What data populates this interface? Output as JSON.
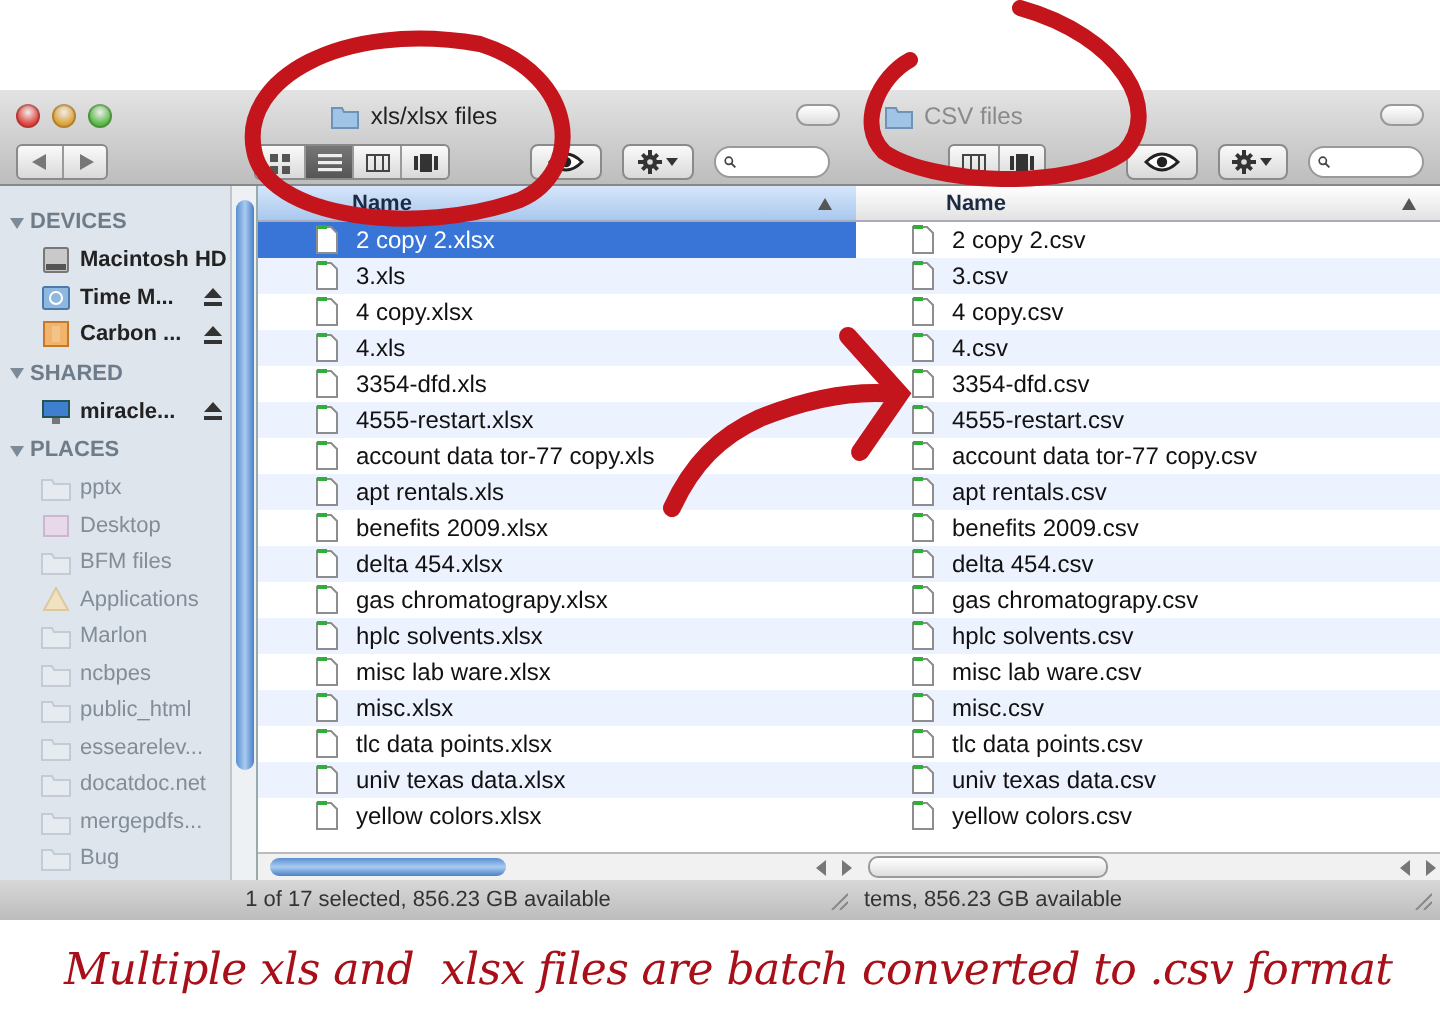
{
  "windows": [
    {
      "title": "xls/xlsx files",
      "active": true,
      "traffic_lights": true,
      "nav_buttons": true,
      "view_buttons": [
        {
          "kind": "icon",
          "selected": false
        },
        {
          "kind": "list",
          "selected": true
        },
        {
          "kind": "column",
          "selected": false
        },
        {
          "kind": "coverflow",
          "selected": false
        }
      ],
      "sidebar": {
        "sections": [
          {
            "header": "DEVICES",
            "expanded": true,
            "items": [
              {
                "kind": "drive",
                "label": "Macintosh HD",
                "eject": false,
                "dimmed": false
              },
              {
                "kind": "backup",
                "label": "Time M...",
                "eject": true,
                "dimmed": false
              },
              {
                "kind": "external",
                "label": "Carbon ...",
                "eject": true,
                "dimmed": false
              }
            ]
          },
          {
            "header": "SHARED",
            "expanded": true,
            "items": [
              {
                "kind": "network",
                "label": "miracle...",
                "eject": true,
                "dimmed": false
              }
            ]
          },
          {
            "header": "PLACES",
            "expanded": true,
            "items": [
              {
                "kind": "folder",
                "label": "pptx",
                "eject": false,
                "dimmed": true
              },
              {
                "kind": "desktop",
                "label": "Desktop",
                "eject": false,
                "dimmed": true
              },
              {
                "kind": "folder",
                "label": "BFM files",
                "eject": false,
                "dimmed": true
              },
              {
                "kind": "apps",
                "label": "Applications",
                "eject": false,
                "dimmed": true
              },
              {
                "kind": "folder",
                "label": "Marlon",
                "eject": false,
                "dimmed": true
              },
              {
                "kind": "folder",
                "label": "ncbpes",
                "eject": false,
                "dimmed": true
              },
              {
                "kind": "folder",
                "label": "public_html",
                "eject": false,
                "dimmed": true
              },
              {
                "kind": "folder",
                "label": "essearelev...",
                "eject": false,
                "dimmed": true
              },
              {
                "kind": "folder",
                "label": "docatdoc.net",
                "eject": false,
                "dimmed": true
              },
              {
                "kind": "folder",
                "label": "mergepdfs...",
                "eject": false,
                "dimmed": true
              },
              {
                "kind": "folder",
                "label": "Bug",
                "eject": false,
                "dimmed": true
              }
            ]
          }
        ]
      },
      "column": "Name",
      "files": [
        {
          "name": "2 copy 2.xlsx",
          "selected": true
        },
        {
          "name": "3.xls",
          "selected": false
        },
        {
          "name": "4 copy.xlsx",
          "selected": false
        },
        {
          "name": "4.xls",
          "selected": false
        },
        {
          "name": "3354-dfd.xls",
          "selected": false
        },
        {
          "name": "4555-restart.xlsx",
          "selected": false
        },
        {
          "name": "account data tor-77 copy.xls",
          "selected": false
        },
        {
          "name": "apt rentals.xls",
          "selected": false
        },
        {
          "name": "benefits 2009.xlsx",
          "selected": false
        },
        {
          "name": "delta 454.xlsx",
          "selected": false
        },
        {
          "name": "gas chromatograpy.xlsx",
          "selected": false
        },
        {
          "name": "hplc solvents.xlsx",
          "selected": false
        },
        {
          "name": "misc lab ware.xlsx",
          "selected": false
        },
        {
          "name": "misc.xlsx",
          "selected": false
        },
        {
          "name": "tlc data points.xlsx",
          "selected": false
        },
        {
          "name": "univ texas data.xlsx",
          "selected": false
        },
        {
          "name": "yellow colors.xlsx",
          "selected": false
        }
      ],
      "status": "1 of 17 selected, 856.23 GB available"
    },
    {
      "title": "CSV files",
      "active": false,
      "traffic_lights": false,
      "nav_buttons": false,
      "view_buttons": [
        {
          "kind": "column",
          "selected": false
        },
        {
          "kind": "coverflow",
          "selected": false
        }
      ],
      "column": "Name",
      "files": [
        {
          "name": "2 copy 2.csv",
          "selected": false
        },
        {
          "name": "3.csv",
          "selected": false
        },
        {
          "name": "4 copy.csv",
          "selected": false
        },
        {
          "name": "4.csv",
          "selected": false
        },
        {
          "name": "3354-dfd.csv",
          "selected": false
        },
        {
          "name": "4555-restart.csv",
          "selected": false
        },
        {
          "name": "account data tor-77 copy.csv",
          "selected": false
        },
        {
          "name": "apt rentals.csv",
          "selected": false
        },
        {
          "name": "benefits 2009.csv",
          "selected": false
        },
        {
          "name": "delta 454.csv",
          "selected": false
        },
        {
          "name": "gas chromatograpy.csv",
          "selected": false
        },
        {
          "name": "hplc solvents.csv",
          "selected": false
        },
        {
          "name": "misc lab ware.csv",
          "selected": false
        },
        {
          "name": "misc.csv",
          "selected": false
        },
        {
          "name": "tlc data points.csv",
          "selected": false
        },
        {
          "name": "univ texas data.csv",
          "selected": false
        },
        {
          "name": "yellow colors.csv",
          "selected": false
        }
      ],
      "status": "tems, 856.23 GB available"
    }
  ],
  "caption": "Multiple xls and  xlsx files are batch converted to .csv format"
}
